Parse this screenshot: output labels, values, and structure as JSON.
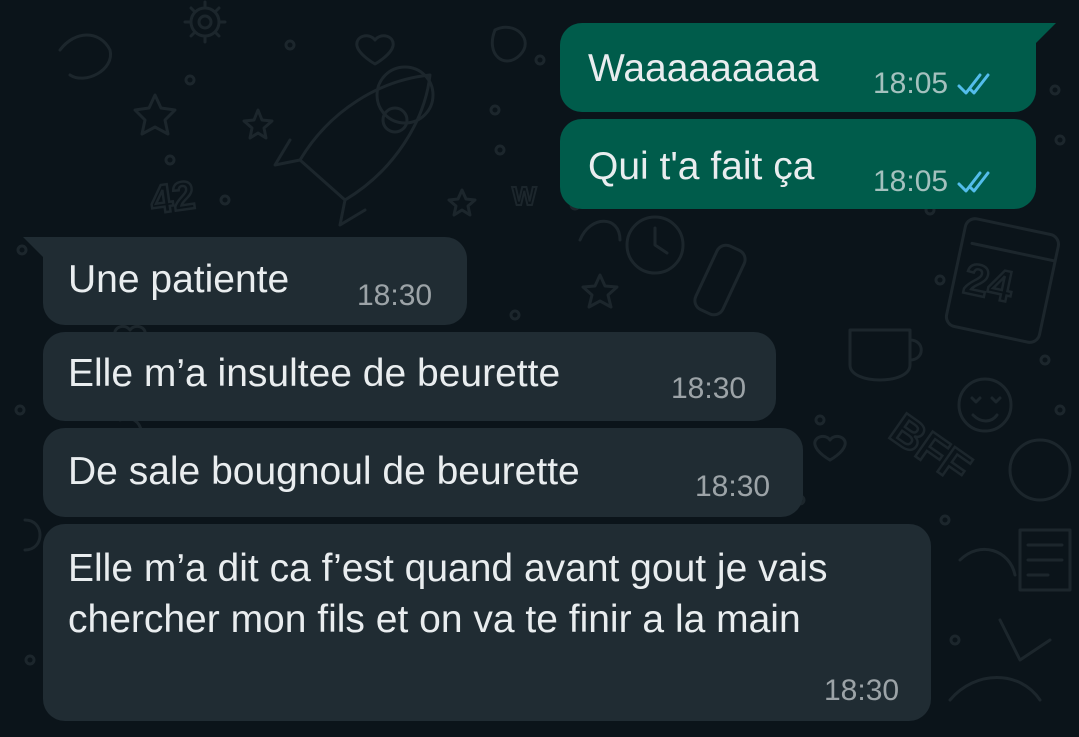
{
  "colors": {
    "background": "#0b141a",
    "outgoing_bubble": "#005c4b",
    "incoming_bubble": "#202c33",
    "text": "#e9edef",
    "read_ticks": "#53bdeb"
  },
  "wallpaper": {
    "doodles": [
      "gear-icon",
      "star-icon",
      "rocket-icon",
      "heart-icon",
      "clock-icon",
      "calendar-icon",
      "cup-icon",
      "bottle-icon",
      "smiley-icon",
      "number-42",
      "letters-bff",
      "number-24"
    ],
    "doodle_text": {
      "n42": "42",
      "n24": "24",
      "bff": "BFF",
      "w": "W"
    }
  },
  "messages": [
    {
      "id": "m1",
      "direction": "outgoing",
      "text": "Waaaaaaaaa",
      "time": "18:05",
      "status": "read",
      "status_icon": "double-check-icon"
    },
    {
      "id": "m2",
      "direction": "outgoing",
      "text": "Qui t'a fait ça",
      "time": "18:05",
      "status": "read",
      "status_icon": "double-check-icon"
    },
    {
      "id": "m3",
      "direction": "incoming",
      "text": "Une patiente",
      "time": "18:30"
    },
    {
      "id": "m4",
      "direction": "incoming",
      "text": "Elle m’a insultee de beurette",
      "time": "18:30"
    },
    {
      "id": "m5",
      "direction": "incoming",
      "text": "De sale bougnoul de beurette",
      "time": "18:30"
    },
    {
      "id": "m6",
      "direction": "incoming",
      "text": "Elle m’a dit ca f’est quand avant gout je vais chercher mon fils et on va te finir a la main",
      "time": "18:30"
    }
  ]
}
